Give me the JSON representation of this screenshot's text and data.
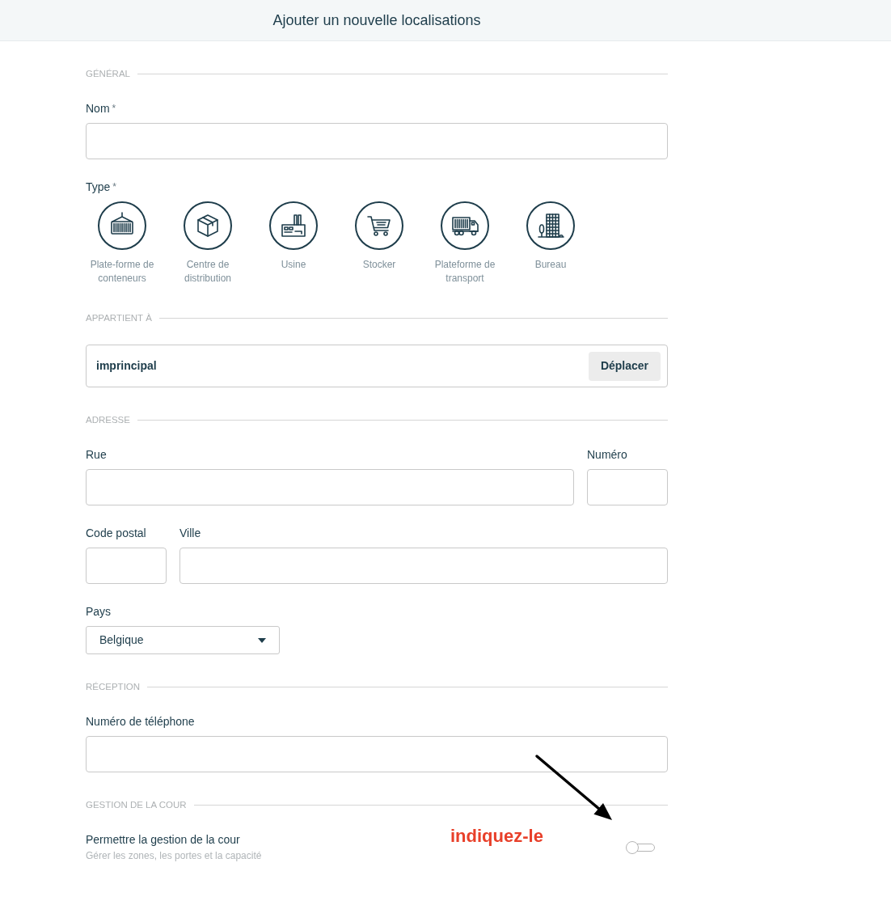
{
  "header": {
    "title": "Ajouter un nouvelle localisations"
  },
  "sections": [
    {
      "heading": "GÉNÉRAL",
      "rows": [
        [
          {
            "kind": "text",
            "label": "Nom",
            "required_mark": "*"
          }
        ],
        [
          {
            "kind": "type_picker",
            "label": "Type",
            "required_mark": "*",
            "options": [
              {
                "label": "Plate-forme de conteneurs",
                "selected": false
              },
              {
                "label": "Centre de distribution",
                "selected": false
              },
              {
                "label": "Usine",
                "selected": false
              },
              {
                "label": "Stocker",
                "selected": false
              },
              {
                "label": "Plateforme de transport",
                "selected": false
              },
              {
                "label": "Bureau",
                "selected": false
              }
            ]
          }
        ]
      ]
    },
    {
      "heading": "APPARTIENT À",
      "rows": [
        [
          {
            "kind": "parent",
            "value": "imprincipal",
            "button": "Déplacer"
          }
        ]
      ]
    },
    {
      "heading": "ADRESSE",
      "rows": [
        [
          {
            "kind": "text",
            "label": "Rue"
          },
          {
            "kind": "short_text",
            "label": "Numéro"
          }
        ],
        [
          {
            "kind": "short_text",
            "label": "Code postal"
          },
          {
            "kind": "text",
            "label": "Ville"
          }
        ],
        [
          {
            "kind": "select",
            "label": "Pays",
            "value": "Belgique"
          }
        ]
      ]
    },
    {
      "heading": "RÉCEPTION",
      "rows": [
        [
          {
            "kind": "text",
            "label": "Numéro de téléphone"
          }
        ]
      ]
    },
    {
      "heading": "GESTION DE LA COUR",
      "rows": [
        [
          {
            "kind": "toggle",
            "label": "Permettre la gestion de la cour",
            "description": "Gérer les zones, les portes et la capacité",
            "on": false
          }
        ]
      ]
    }
  ],
  "annotation": {
    "text": "indiquez-le"
  }
}
